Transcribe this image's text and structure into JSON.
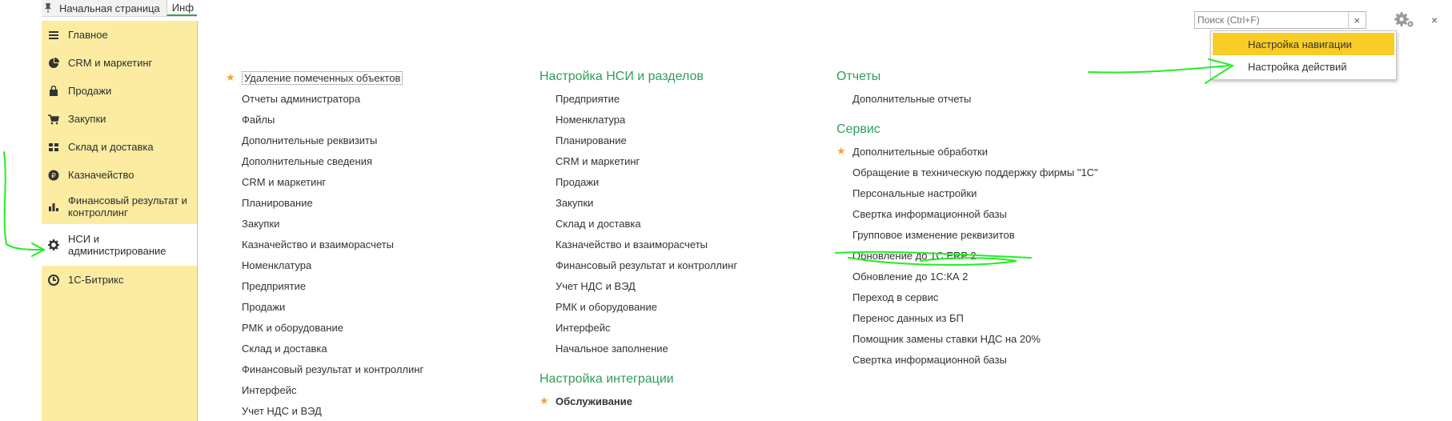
{
  "tabs": {
    "home": "Начальная страница",
    "current": "Инф"
  },
  "sidebar": {
    "items": [
      {
        "label": "Главное",
        "icon": "menu-icon"
      },
      {
        "label": "CRM и маркетинг",
        "icon": "pie-chart-icon"
      },
      {
        "label": "Продажи",
        "icon": "shopping-bag-icon"
      },
      {
        "label": "Закупки",
        "icon": "cart-icon"
      },
      {
        "label": "Склад и доставка",
        "icon": "warehouse-icon"
      },
      {
        "label": "Казначейство",
        "icon": "ruble-coin-icon"
      },
      {
        "label": "Финансовый результат и контроллинг",
        "icon": "bar-chart-icon"
      },
      {
        "label": "НСИ и администрирование",
        "icon": "gear-icon"
      },
      {
        "label": "1С-Битрикс",
        "icon": "bitrix-icon"
      }
    ],
    "active_index": 7
  },
  "col1": {
    "links": [
      "Удаление помеченных объектов",
      "Отчеты администратора",
      "Файлы",
      "Дополнительные реквизиты",
      "Дополнительные сведения",
      "CRM и маркетинг",
      "Планирование",
      "Закупки",
      "Казначейство и взаиморасчеты",
      "Номенклатура",
      "Предприятие",
      "Продажи",
      "РМК и оборудование",
      "Склад и доставка",
      "Финансовый результат и контроллинг",
      "Интерфейс",
      "Учет НДС и ВЭД"
    ]
  },
  "col2": {
    "section1": "Настройка НСИ и разделов",
    "links": [
      "Предприятие",
      "Номенклатура",
      "Планирование",
      "CRM и маркетинг",
      "Продажи",
      "Закупки",
      "Склад и доставка",
      "Казначейство и взаиморасчеты",
      "Финансовый результат и контроллинг",
      "Учет НДС и ВЭД",
      "РМК и оборудование",
      "Интерфейс",
      "Начальное заполнение"
    ],
    "section2": "Настройка интеграции",
    "links2": [
      "Обслуживание"
    ]
  },
  "col3": {
    "section1": "Отчеты",
    "links": [
      "Дополнительные отчеты"
    ],
    "section2": "Сервис",
    "links2": [
      "Дополнительные обработки",
      "Обращение в техническую поддержку фирмы \"1С\"",
      "Персональные настройки",
      "Свертка информационной базы",
      "Групповое изменение реквизитов",
      "Обновление до 1С:ERP 2",
      "Обновление до 1С:КА 2",
      "Переход в сервис",
      "Перенос данных из БП",
      "Помощник замены ставки НДС на 20%",
      "Свертка информационной базы"
    ]
  },
  "search": {
    "placeholder": "Поиск (Ctrl+F)",
    "clear": "×"
  },
  "toolbar": {
    "close": "×"
  },
  "dropdown": {
    "items": [
      "Настройка навигации",
      "Настройка действий"
    ]
  },
  "colors": {
    "sidebar_bg": "#fbeca2",
    "section_green": "#2f9e57",
    "highlight": "#f9cd26",
    "star": "#f4a23a",
    "annotation": "#22ee22"
  }
}
